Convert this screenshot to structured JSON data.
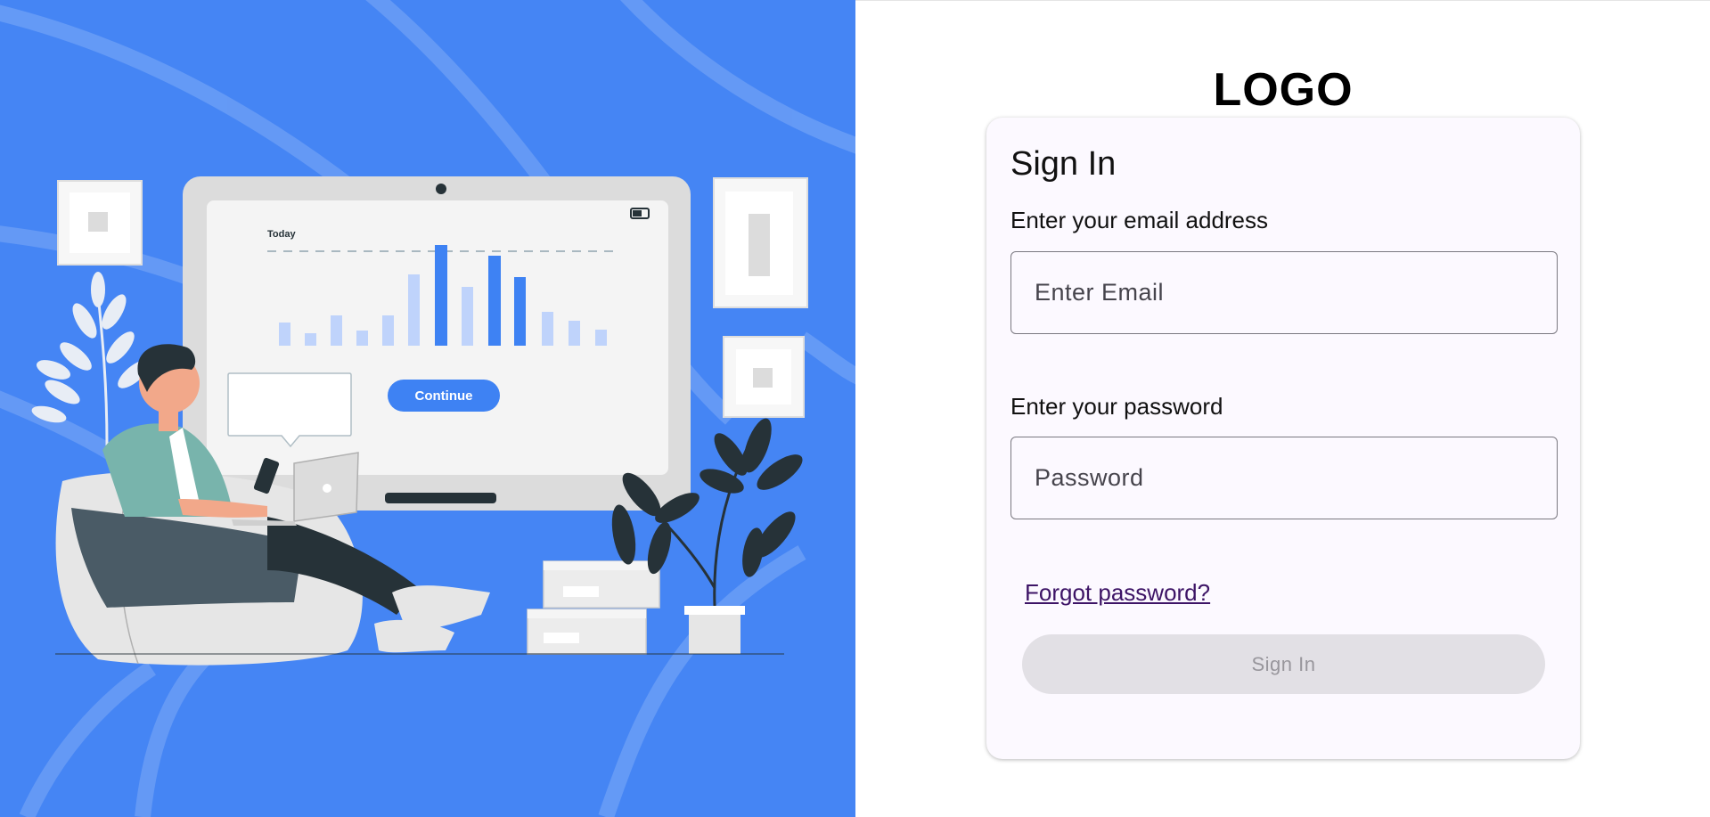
{
  "hero": {
    "chart_heading": "Today",
    "continue_label": "Continue",
    "background_color": "#4585f4"
  },
  "logo": "LOGO",
  "signin_card": {
    "title": "Sign In",
    "email_label": "Enter your email address",
    "email_placeholder": "Enter Email",
    "email_value": "",
    "password_label": "Enter your password",
    "password_placeholder": "Password",
    "password_value": "",
    "forgot_label": "Forgot password?",
    "signin_label": "Sign In",
    "signin_enabled": false
  }
}
